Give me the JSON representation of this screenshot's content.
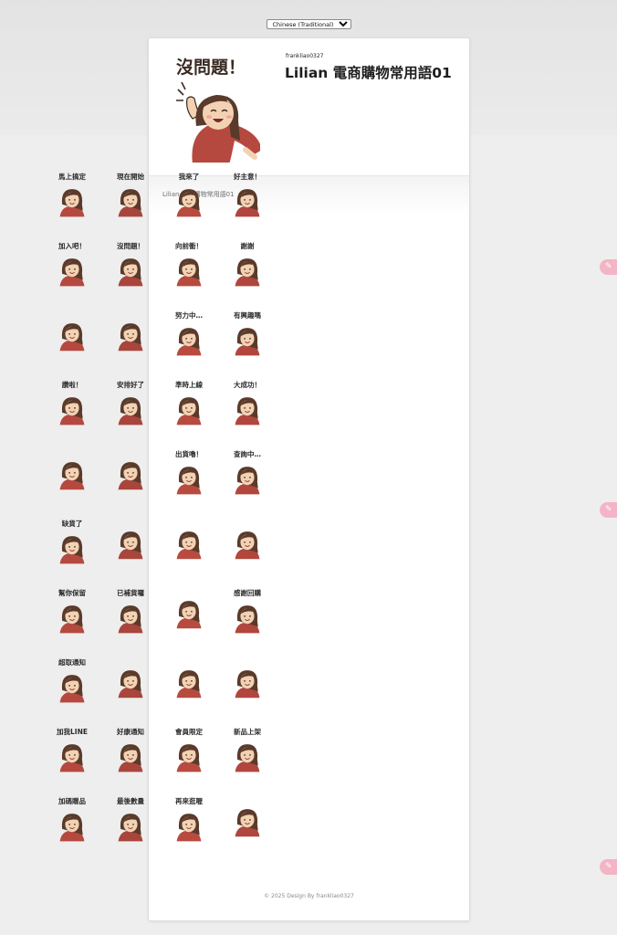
{
  "language_select": {
    "value": "Chinese (Traditional)"
  },
  "header": {
    "hero_caption": "沒問題！",
    "author": "frankliao0327",
    "title": "Lilian 電商購物常用語01"
  },
  "section": {
    "title": "Lilian 電商購物常用語01"
  },
  "stickers": [
    "馬上搞定",
    "現在開始",
    "我來了",
    "好主意！",
    "加入吧！",
    "沒問題！",
    "向前衝！",
    "謝謝",
    "",
    "",
    "努力中…",
    "有興趣嗎",
    "讚啦！",
    "安排好了",
    "準時上線",
    "大成功！",
    "",
    "",
    "出貨嚕！",
    "查詢中…",
    "缺貨了",
    "",
    "",
    "",
    "幫你保留",
    "已補貨囉",
    "",
    "感謝回購",
    "超取通知",
    "",
    "",
    "",
    "加我LINE",
    "好康通知",
    "會員限定",
    "新品上架",
    "加碼贈品",
    "最後數量",
    "再來逛喔",
    ""
  ],
  "footer": {
    "text": "© 2025 Design By frankliao0327"
  },
  "colors": {
    "hair": "#5a3a2a",
    "skin": "#f3d2b4",
    "shirt": "#b5493f",
    "accent_pink": "#f3b4c6"
  }
}
